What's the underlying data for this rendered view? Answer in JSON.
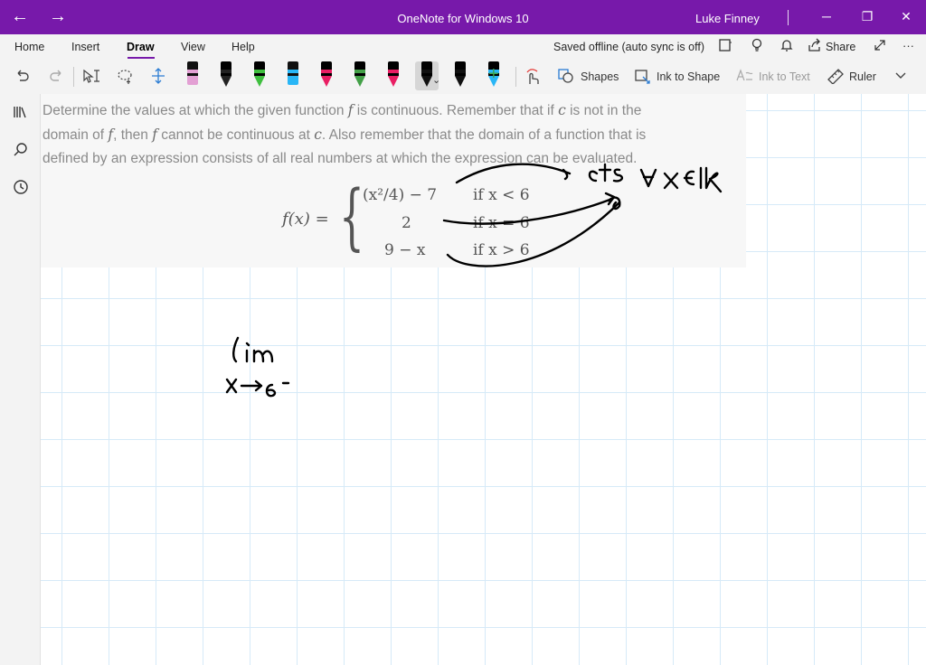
{
  "window": {
    "title": "OneNote for Windows 10",
    "user": "Luke Finney",
    "back_glyph": "←",
    "forward_glyph": "→",
    "minimize_glyph": "─",
    "restore_glyph": "❐",
    "close_glyph": "✕",
    "accent": "#7719aa"
  },
  "menu": {
    "tabs": [
      "Home",
      "Insert",
      "Draw",
      "View",
      "Help"
    ],
    "active_tab": "Draw",
    "status": "Saved offline (auto sync is off)",
    "share_label": "Share",
    "more_glyph": "···"
  },
  "toolbar": {
    "shapes_label": "Shapes",
    "ink_to_shape_label": "Ink to Shape",
    "ink_to_text_label": "Ink to Text",
    "ruler_label": "Ruler",
    "pens": [
      {
        "color": "#e3a0d4",
        "kind": "highlighter"
      },
      {
        "color": "#222222",
        "kind": "pen"
      },
      {
        "color": "#3fbf3f",
        "kind": "pen"
      },
      {
        "color": "#29b6f6",
        "kind": "highlighter"
      },
      {
        "color": "#e91e63",
        "kind": "pen"
      },
      {
        "color": "#43a047",
        "kind": "pen"
      },
      {
        "color": "#e91e63",
        "kind": "pen"
      },
      {
        "color": "#111111",
        "kind": "pen",
        "selected": true
      },
      {
        "color": "#111111",
        "kind": "pen"
      },
      {
        "color": "#29b6f6",
        "kind": "pen"
      }
    ]
  },
  "page": {
    "problem_text": {
      "line1_a": "Determine the values at which the given function ",
      "f1": "f",
      "line1_b": " is continuous. Remember that if ",
      "c1": "c",
      "line1_c": " is not in the",
      "line2_a": "domain of ",
      "f2": "f",
      "line2_b": ", then ",
      "f3": "f",
      "line2_c": " cannot be continuous at ",
      "c2": "c",
      "line2_d": ". Also remember that the domain of a function that is",
      "line3": "defined by an expression consists of all real numbers at which the expression can be evaluated."
    },
    "formula": {
      "lhs": "f(x) =",
      "cases": [
        {
          "expr": "(x²/4) − 7",
          "cond": "if x < 6"
        },
        {
          "expr": "2",
          "cond": "if x = 6"
        },
        {
          "expr": "9 − x",
          "cond": "if x > 6"
        }
      ]
    }
  }
}
